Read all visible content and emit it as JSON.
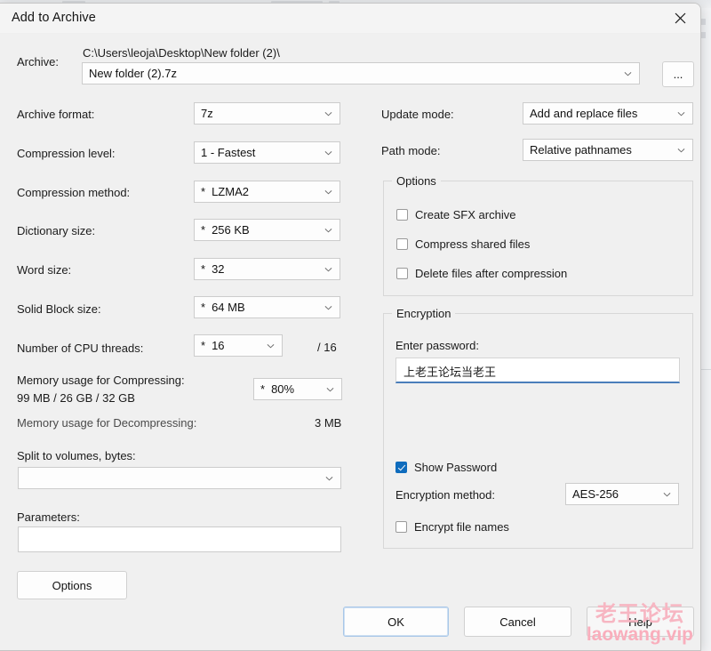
{
  "window": {
    "title": "Add to Archive",
    "close_icon": "close-icon"
  },
  "archive": {
    "label": "Archive:",
    "path": "C:\\Users\\leoja\\Desktop\\New folder (2)\\",
    "name_value": "New folder (2).7z",
    "browse_label": "..."
  },
  "left": {
    "archive_format": {
      "label": "Archive format:",
      "value": "7z",
      "star": false
    },
    "compression_level": {
      "label": "Compression level:",
      "value": "1 - Fastest",
      "star": false
    },
    "compression_method": {
      "label": "Compression method:",
      "value": "LZMA2",
      "star": true
    },
    "dictionary_size": {
      "label": "Dictionary size:",
      "value": "256 KB",
      "star": true
    },
    "word_size": {
      "label": "Word size:",
      "value": "32",
      "star": true
    },
    "solid_block_size": {
      "label": "Solid Block size:",
      "value": "64 MB",
      "star": true
    },
    "cpu_threads": {
      "label": "Number of CPU threads:",
      "value": "16",
      "star": true,
      "total": "/ 16"
    },
    "memory_compress": {
      "label": "Memory usage for Compressing:",
      "detail": "99 MB / 26 GB / 32 GB",
      "value": "80%",
      "star": true
    },
    "memory_decompress": {
      "label": "Memory usage for Decompressing:",
      "value": "3 MB"
    },
    "split_volumes": {
      "label": "Split to volumes, bytes:",
      "value": ""
    },
    "parameters": {
      "label": "Parameters:",
      "value": ""
    },
    "options_button": "Options"
  },
  "right": {
    "update_mode": {
      "label": "Update mode:",
      "value": "Add and replace files"
    },
    "path_mode": {
      "label": "Path mode:",
      "value": "Relative pathnames"
    },
    "options_group": {
      "title": "Options",
      "items": [
        {
          "label": "Create SFX archive",
          "checked": false
        },
        {
          "label": "Compress shared files",
          "checked": false
        },
        {
          "label": "Delete files after compression",
          "checked": false
        }
      ]
    },
    "encryption_group": {
      "title": "Encryption",
      "password_label": "Enter password:",
      "password_value": "上老王论坛当老王",
      "show_password": {
        "label": "Show Password",
        "checked": true
      },
      "encryption_method": {
        "label": "Encryption method:",
        "value": "AES-256"
      },
      "encrypt_file_names": {
        "label": "Encrypt file names",
        "checked": false
      }
    }
  },
  "footer": {
    "ok": "OK",
    "cancel": "Cancel",
    "help": "Help"
  },
  "watermark": {
    "cn": "老王论坛",
    "en": "laowang.vip"
  },
  "colors": {
    "accent": "#0f6cbd",
    "focus_underline": "#4a7ebb",
    "dialog_bg": "#f0f0f0",
    "watermark": "#f7b6c2"
  }
}
